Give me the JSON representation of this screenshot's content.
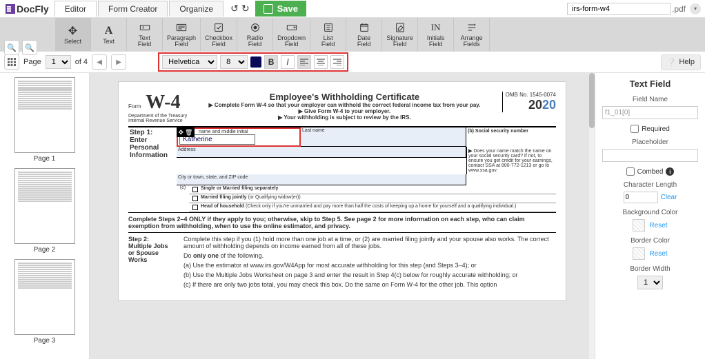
{
  "logo": "DocFly",
  "tabs": {
    "editor": "Editor",
    "form_creator": "Form Creator",
    "organize": "Organize"
  },
  "save_label": "Save",
  "filename": "irs-form-w4",
  "ext": ".pdf",
  "tools": {
    "select": "Select",
    "text": "Text",
    "text_field": "Text\nField",
    "paragraph_field": "Paragraph\nField",
    "checkbox_field": "Checkbox\nField",
    "radio_field": "Radio\nField",
    "dropdown_field": "Dropdown\nField",
    "list_field": "List\nField",
    "date_field": "Date\nField",
    "signature_field": "Signature\nField",
    "initials_field": "Initials\nField",
    "arrange_fields": "Arrange\nFields"
  },
  "page_label": "Page",
  "page_num": "1",
  "page_total": "of 4",
  "font_name": "Helvetica",
  "font_size": "8",
  "help_label": "Help",
  "thumbs": [
    "Page 1",
    "Page 2",
    "Page 3"
  ],
  "doc": {
    "form_word": "Form",
    "w4": "W-4",
    "title": "Employee's Withholding Certificate",
    "line1": "Complete Form W-4 so that your employer can withhold the correct federal income tax from your pay.",
    "line2": "Give Form W-4 to your employer.",
    "line3": "Your withholding is subject to review by the IRS.",
    "omb": "OMB No. 1545-0074",
    "year1": "20",
    "year2": "20",
    "dept": "Department of the Treasury\nInternal Revenue Service",
    "step1": "Step 1:",
    "step1b": "Enter\nPersonal\nInformation",
    "fn_label": "name and middle initial",
    "fn_value": "Katherine",
    "ln_label": "Last name",
    "addr_label": "Address",
    "city_label": "City or town, state, and ZIP code",
    "ssn_label": "Social security number",
    "ssn_letter": "(b)",
    "does_name": "Does your name match the name on your social security card? If not, to ensure you get credit for your earnings, contact SSA at 800-772-1213 or go to www.ssa.gov.",
    "c_letter": "(c)",
    "cb1": "Single or Married filing separately",
    "cb2a": "Married filing jointly",
    "cb2b": " (or Qualifying widow(er))",
    "cb3a": "Head of household",
    "cb3b": " (Check only if you're unmarried and pay more than half the costs of keeping up a home for yourself and a qualifying individual.)",
    "instr": "Complete Steps 2–4 ONLY if they apply to you; otherwise, skip to Step 5. See page 2 for more information on each step, who can claim exemption from withholding, when to use the online estimator, and privacy.",
    "step2": "Step 2:",
    "step2b": "Multiple Jobs\nor Spouse\nWorks",
    "s2p1": "Complete this step if you (1) hold more than one job at a time, or (2) are married filing jointly and your spouse also works. The correct amount of withholding depends on income earned from all of these jobs.",
    "s2p2a": "Do ",
    "s2p2b": "only one",
    "s2p2c": " of the following.",
    "s2a": "(a)  Use the estimator at www.irs.gov/W4App for most accurate withholding for this step (and Steps 3–4); or",
    "s2b": "(b)  Use the Multiple Jobs Worksheet on page 3 and enter the result in Step 4(c) below for roughly accurate withholding; or",
    "s2c": "(c)  If there are only two jobs total, you may check this box. Do the same on Form W-4 for the other job. This option"
  },
  "panel": {
    "title": "Text Field",
    "field_name_lbl": "Field Name",
    "field_name": "f1_01[0]",
    "required": "Required",
    "placeholder_lbl": "Placeholder",
    "combed": "Combed",
    "charlen": "Character Length",
    "charlen_val": "0",
    "clear": "Clear",
    "bgcolor": "Background Color",
    "reset": "Reset",
    "bordercolor": "Border Color",
    "borderwidth": "Border Width",
    "bw_val": "1"
  }
}
